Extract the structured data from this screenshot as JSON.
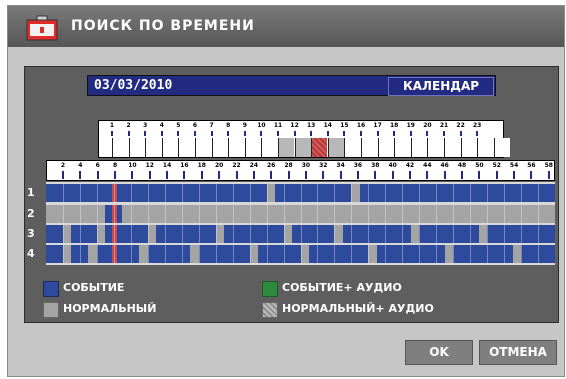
{
  "window": {
    "title": "ПОИСК ПО ВРЕМЕНИ"
  },
  "date_bar": {
    "date": "03/03/2010",
    "calendar_label": "КАЛЕНДАР"
  },
  "hours_ruler": {
    "labels": [
      "1",
      "2",
      "3",
      "4",
      "5",
      "6",
      "7",
      "8",
      "9",
      "10",
      "11",
      "12",
      "13",
      "14",
      "15",
      "16",
      "17",
      "18",
      "19",
      "20",
      "21",
      "22",
      "23"
    ],
    "selected_hour": "12"
  },
  "minutes_ruler": {
    "labels": [
      "2",
      "4",
      "6",
      "8",
      "10",
      "12",
      "14",
      "16",
      "18",
      "20",
      "22",
      "24",
      "26",
      "28",
      "30",
      "32",
      "34",
      "36",
      "38",
      "40",
      "42",
      "44",
      "46",
      "48",
      "50",
      "52",
      "54",
      "56",
      "58"
    ],
    "cursor_minute": 8
  },
  "channels": [
    {
      "label": "1",
      "segments": [
        [
          0,
          60,
          "event"
        ],
        [
          26,
          27,
          "normal"
        ],
        [
          36,
          37,
          "normal"
        ]
      ]
    },
    {
      "label": "2",
      "segments": [
        [
          0,
          60,
          "normal"
        ],
        [
          7,
          8,
          "event"
        ],
        [
          8,
          9,
          "event"
        ],
        [
          10,
          60,
          "normal"
        ]
      ]
    },
    {
      "label": "3",
      "segments": [
        [
          0,
          60,
          "event"
        ],
        [
          2,
          3,
          "normal"
        ],
        [
          6,
          7,
          "normal"
        ],
        [
          12,
          13,
          "normal"
        ],
        [
          20,
          21,
          "normal"
        ],
        [
          28,
          29,
          "normal"
        ],
        [
          34,
          35,
          "normal"
        ],
        [
          43,
          44,
          "normal"
        ],
        [
          51,
          52,
          "normal"
        ]
      ]
    },
    {
      "label": "4",
      "segments": [
        [
          0,
          60,
          "event"
        ],
        [
          2,
          3,
          "normal"
        ],
        [
          5,
          6,
          "normal"
        ],
        [
          11,
          12,
          "normal"
        ],
        [
          17,
          18,
          "normal"
        ],
        [
          24,
          25,
          "normal"
        ],
        [
          30,
          31,
          "normal"
        ],
        [
          38,
          39,
          "normal"
        ],
        [
          47,
          48,
          "normal"
        ],
        [
          55,
          56,
          "normal"
        ]
      ]
    }
  ],
  "legend": {
    "event": "СОБЫТИЕ",
    "normal": "НОРМАЛЬНЫЙ",
    "event_audio": "СОБЫТИЕ+ АУДИО",
    "normal_audio": "НОРМАЛЬНЫЙ+ АУДИО"
  },
  "colors": {
    "event": "#2d4a9c",
    "normal": "#a4a4a4",
    "event_audio": "#2f8a3f",
    "normal_audio": "#bdbdbd",
    "cursor": "#c84a4a",
    "tick": "#222a82"
  },
  "buttons": {
    "ok": "OK",
    "cancel": "ОТМЕНА"
  }
}
